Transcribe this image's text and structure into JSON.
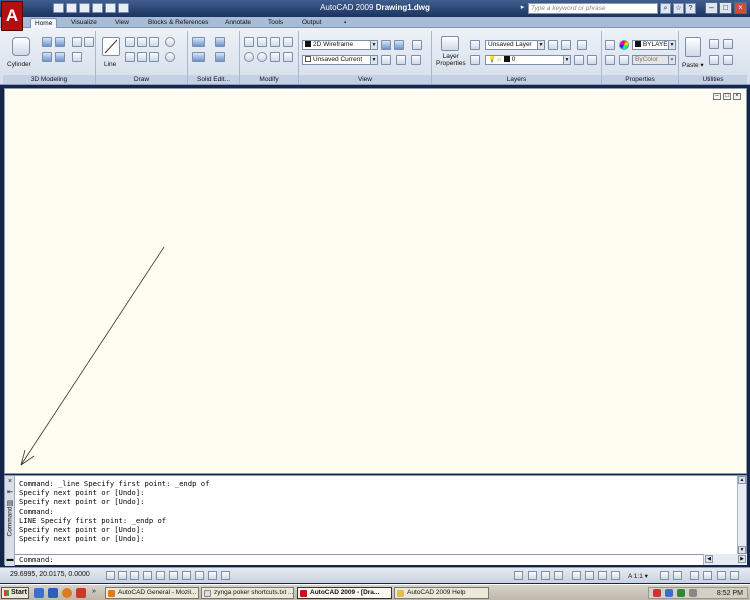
{
  "window": {
    "app_name": "AutoCAD 2009",
    "file_name": "Drawing1.dwg",
    "search_placeholder": "Type a keyword or phrase"
  },
  "tabs": [
    {
      "label": "Home",
      "active": true
    },
    {
      "label": "Visualize"
    },
    {
      "label": "View"
    },
    {
      "label": "Blocks & References"
    },
    {
      "label": "Annotate"
    },
    {
      "label": "Tools"
    },
    {
      "label": "Output"
    }
  ],
  "ribbon": {
    "modeling": {
      "title": "3D Modeling",
      "cylinder_label": "Cylinder"
    },
    "draw": {
      "title": "Draw",
      "line_label": "Line"
    },
    "solid_editing": {
      "title": "Solid Edit..."
    },
    "modify": {
      "title": "Modify"
    },
    "view": {
      "title": "View",
      "visual_style": "2D Wireframe",
      "view_name": "Unsaved Current"
    },
    "layers": {
      "title": "Layers",
      "layer_properties_label": "Layer\nProperties",
      "layer_state": "Unsaved Layer",
      "current_layer": "0"
    },
    "properties": {
      "title": "Properties",
      "color": "BYLAYER",
      "color_value": "ByColor"
    },
    "utilities": {
      "title": "Utilities",
      "paste_label": "Paste"
    }
  },
  "command_history": [
    "Command: _line Specify first point: _endp of",
    "Specify next point or [Undo]:",
    "Specify next point or [Undo]:",
    "Command:",
    "LINE Specify first point: _endp of",
    "Specify next point or [Undo]:",
    "Specify next point or [Undo]:"
  ],
  "command_prompt": "Command:",
  "command_side_label": "Command",
  "status": {
    "coordinates": "29.6995, 20.0175, 0.0000",
    "annotation_scale": "1:1"
  },
  "taskbar": {
    "start_label": "Start",
    "tasks": [
      {
        "label": "AutoCAD General - Mozil...",
        "color": "#e07a1f"
      },
      {
        "label": "zynga poker shortcuts.txt ...",
        "color": "#dcdcdc"
      },
      {
        "label": "AutoCAD 2009 - [Dra...",
        "color": "#c0161c",
        "active": true
      },
      {
        "label": "AutoCAD 2009 Help",
        "color": "#e0c040"
      }
    ],
    "clock": "8:52 PM"
  },
  "colors": {
    "drawing_bg": "#fffdf1",
    "ribbon_bg": "#dfe6f0",
    "title_bar": "#1b3360",
    "app_logo": "#b40f10"
  }
}
